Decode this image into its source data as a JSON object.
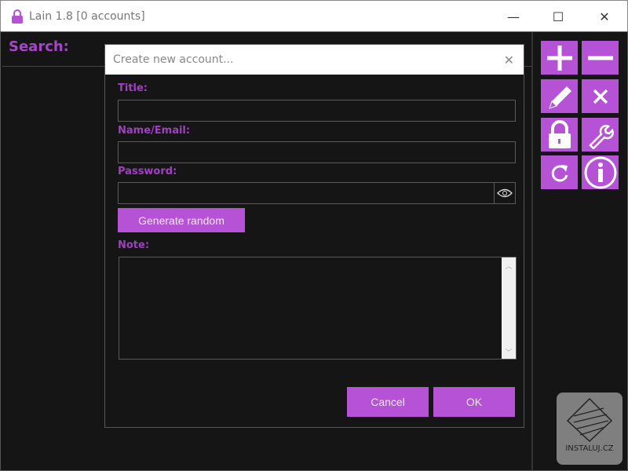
{
  "window": {
    "title": "Lain 1.8 [0 accounts]",
    "minimize": "—",
    "maximize": "☐",
    "close": "✕"
  },
  "search": {
    "label": "Search:"
  },
  "toolbar": [
    {
      "name": "add-button",
      "icon": "plus-icon"
    },
    {
      "name": "remove-button",
      "icon": "minus-icon"
    },
    {
      "name": "edit-button",
      "icon": "pencil-icon"
    },
    {
      "name": "delete-button",
      "icon": "x-icon"
    },
    {
      "name": "lock-button",
      "icon": "lock-icon"
    },
    {
      "name": "settings-button",
      "icon": "wrench-icon"
    },
    {
      "name": "refresh-button",
      "icon": "refresh-icon"
    },
    {
      "name": "info-button",
      "icon": "info-icon"
    }
  ],
  "dialog": {
    "title": "Create new account...",
    "close": "✕",
    "title_label": "Title:",
    "title_value": "",
    "name_label": "Name/Email:",
    "name_value": "",
    "password_label": "Password:",
    "password_value": "",
    "generate": "Generate random",
    "note_label": "Note:",
    "note_value": "",
    "cancel": "Cancel",
    "ok": "OK"
  },
  "watermark": {
    "text": "INSTALUJ.CZ"
  },
  "colors": {
    "accent": "#b552d6",
    "label": "#a040c0",
    "bg": "#151515"
  }
}
